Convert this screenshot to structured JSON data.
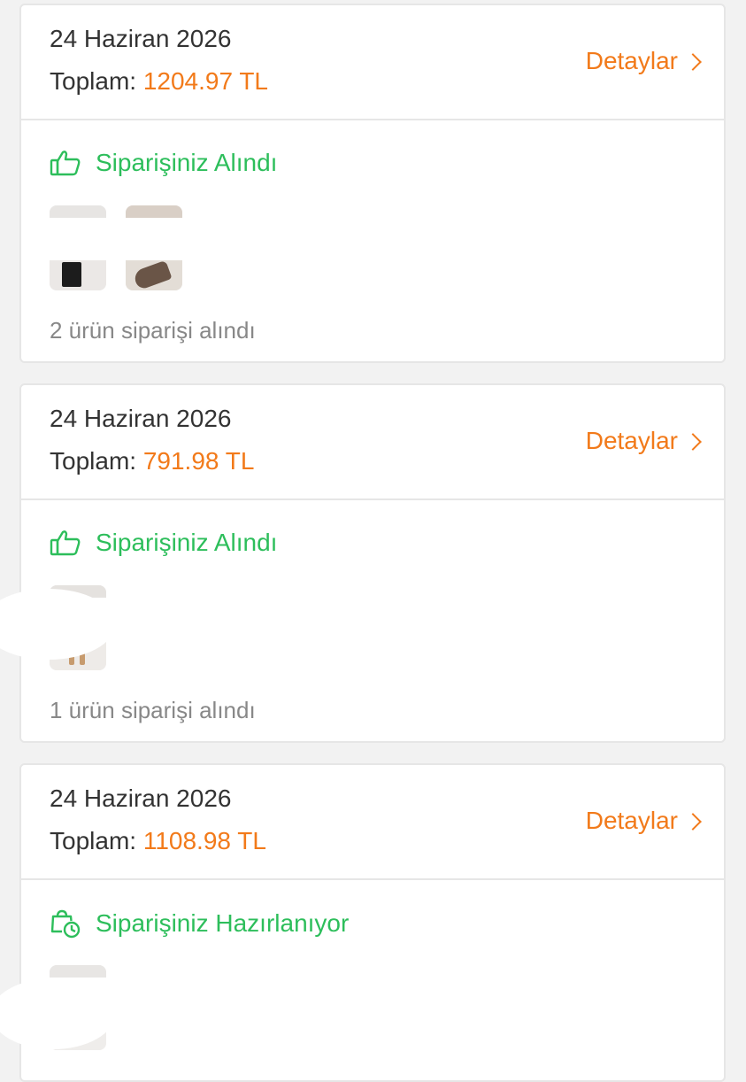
{
  "orders": [
    {
      "date": "24 Haziran 2026",
      "total_label": "Toplam:",
      "total_amount": "1204.97 TL",
      "details_label": "Detaylar",
      "status": "Siparişiniz Alındı",
      "status_icon": "thumbs-up-icon",
      "item_count_text": "2 ürün siparişi alındı"
    },
    {
      "date": "24 Haziran 2026",
      "total_label": "Toplam:",
      "total_amount": "791.98 TL",
      "details_label": "Detaylar",
      "status": "Siparişiniz Alındı",
      "status_icon": "thumbs-up-icon",
      "item_count_text": "1 ürün siparişi alındı"
    },
    {
      "date": "24 Haziran 2026",
      "total_label": "Toplam:",
      "total_amount": "1108.98 TL",
      "details_label": "Detaylar",
      "status": "Siparişiniz Hazırlanıyor",
      "status_icon": "bag-clock-icon"
    }
  ],
  "colors": {
    "accent": "#f27a1a",
    "success": "#2dbe5b",
    "text": "#333333",
    "muted": "#888888"
  }
}
